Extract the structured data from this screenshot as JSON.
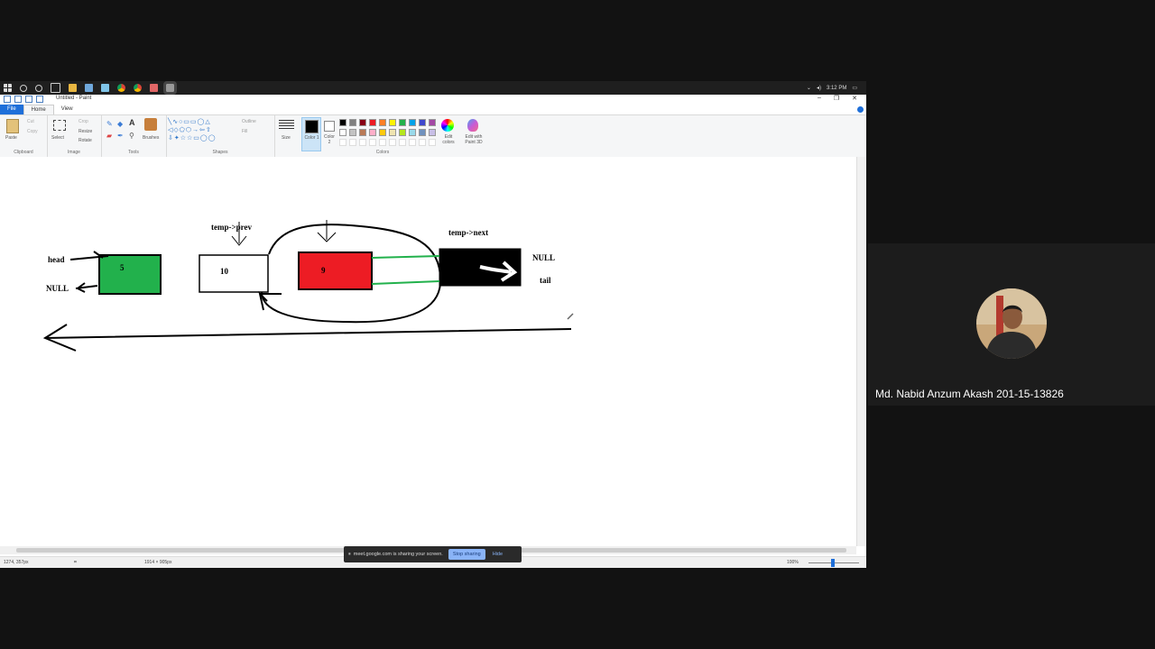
{
  "taskbar": {
    "time": "3:12 PM",
    "icons": [
      "windows-start-icon",
      "search-icon",
      "cortana-icon",
      "task-view-icon",
      "file-explorer-icon",
      "notepad-icon",
      "paint-icon",
      "chrome-icon",
      "chrome-alt-icon",
      "app-icon",
      "app-active-icon"
    ]
  },
  "window": {
    "title": "Untitled - Paint",
    "tabs": [
      "File",
      "Home",
      "View"
    ]
  },
  "ribbon": {
    "clipboard": {
      "paste": "Paste",
      "cut": "Cut",
      "copy": "Copy",
      "label": "Clipboard"
    },
    "image": {
      "select": "Select",
      "crop": "Crop",
      "resize": "Resize",
      "rotate": "Rotate",
      "label": "Image"
    },
    "tools": {
      "label": "Tools",
      "brushes": "Brushes"
    },
    "shapes": {
      "label": "Shapes",
      "outline": "Outline",
      "fill": "Fill"
    },
    "size": "Size",
    "color1": "Color 1",
    "color2": "Color 2",
    "colors_label": "Colors",
    "edit_colors": "Edit colors",
    "paint3d": "Edit with Paint 3D",
    "palette": [
      "#000000",
      "#7f7f7f",
      "#880015",
      "#ed1c24",
      "#ff7f27",
      "#fff200",
      "#22b14c",
      "#00a2e8",
      "#3f48cc",
      "#a349a4",
      "#ffffff",
      "#c3c3c3",
      "#b97a57",
      "#ffaec9",
      "#ffc90e",
      "#efe4b0",
      "#b5e61d",
      "#99d9ea",
      "#7092be",
      "#c8bfe7"
    ]
  },
  "drawing": {
    "labels": {
      "head": "head",
      "null_left": "NULL",
      "temp_prev": "temp->prev",
      "temp_next": "temp->next",
      "null_right": "NULL",
      "tail": "tail"
    },
    "nodes": [
      {
        "value": "5",
        "color": "#22b14c"
      },
      {
        "value": "10",
        "color": "#ffffff"
      },
      {
        "value": "9",
        "color": "#ed1c24"
      },
      {
        "value": "",
        "color": "#000000"
      }
    ]
  },
  "status": {
    "cursor": "1274, 357px",
    "size": "1914 × 905px",
    "zoom": "100%"
  },
  "share": {
    "message": "meet.google.com is sharing your screen.",
    "stop": "Stop sharing",
    "hide": "Hide"
  },
  "participant": {
    "name": "Md. Nabid Anzum Akash 201-15-13826"
  }
}
